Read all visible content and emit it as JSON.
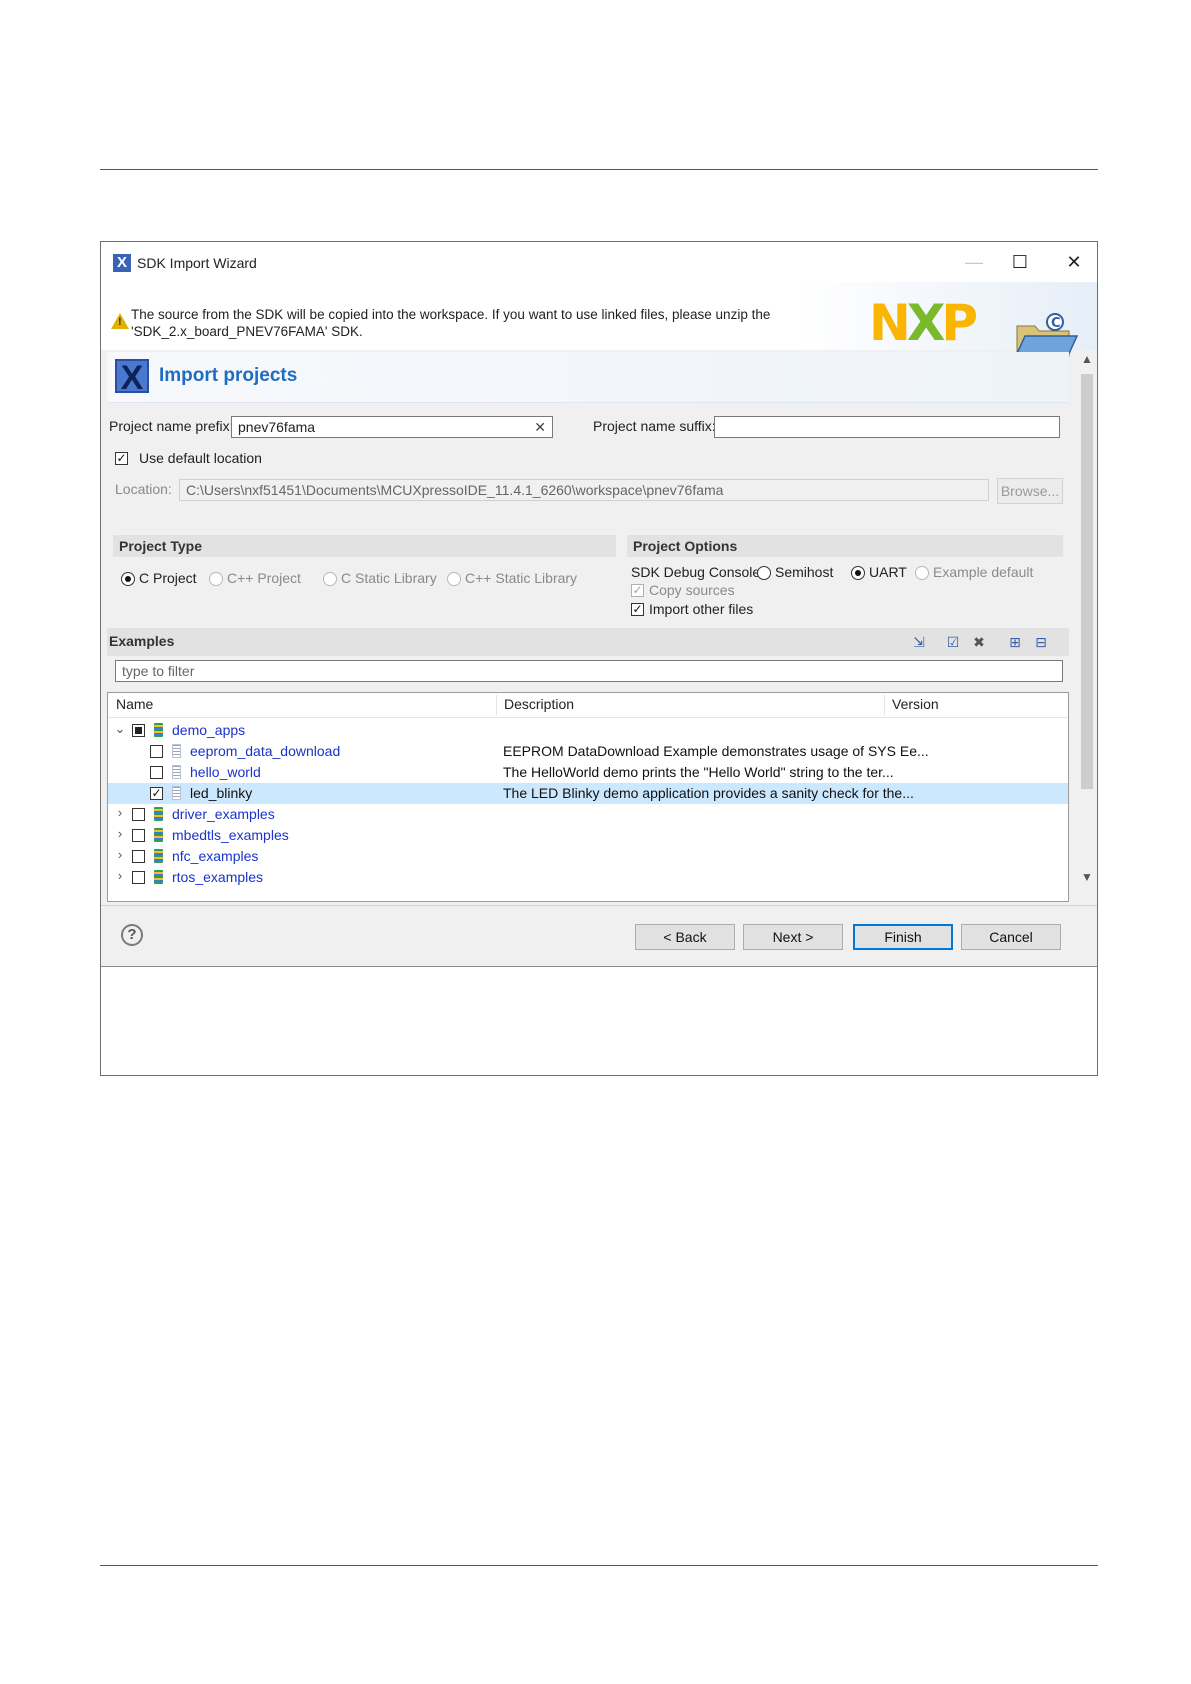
{
  "window": {
    "title": "SDK Import Wizard",
    "minimize_glyph": "—",
    "maximize_glyph": "☐",
    "close_glyph": "✕"
  },
  "warning": {
    "icon": "warning-icon",
    "line1": "The source from the SDK will be copied into the workspace. If you want to use linked files, please unzip the",
    "line2": "'SDK_2.x_board_PNEV76FAMA' SDK."
  },
  "logo": {
    "n": "N",
    "x": "X",
    "p": "P"
  },
  "page": {
    "title": "Import projects"
  },
  "project_name": {
    "prefix_label": "Project name prefix:",
    "prefix_value": "pnev76fama",
    "suffix_label": "Project name suffix:",
    "suffix_value": ""
  },
  "location": {
    "use_default_label": "Use default location",
    "use_default_checked": true,
    "label": "Location:",
    "value": "C:\\Users\\nxf51451\\Documents\\MCUXpressoIDE_11.4.1_6260\\workspace\\pnev76fama",
    "browse_label": "Browse..."
  },
  "project_type": {
    "heading": "Project Type",
    "options": [
      "C Project",
      "C++ Project",
      "C Static Library",
      "C++ Static Library"
    ],
    "selected": "C Project"
  },
  "project_options": {
    "heading": "Project Options",
    "debug_console_label": "SDK Debug Console",
    "console_options": [
      "Semihost",
      "UART",
      "Example default"
    ],
    "console_selected": "UART",
    "copy_sources_label": "Copy sources",
    "import_other_label": "Import other files"
  },
  "examples": {
    "heading": "Examples",
    "filter_placeholder": "type to filter",
    "columns": [
      "Name",
      "Description",
      "Version"
    ],
    "rows": [
      {
        "name": "demo_apps",
        "expanded": "⌄",
        "description": ""
      },
      {
        "name": "eeprom_data_download",
        "description": "EEPROM DataDownload Example demonstrates usage of SYS Ee..."
      },
      {
        "name": "hello_world",
        "description": "The HelloWorld demo prints the \"Hello World\" string to the ter..."
      },
      {
        "name": "led_blinky",
        "description": "The LED Blinky demo application provides a sanity check for the..."
      },
      {
        "name": "driver_examples",
        "expanded": "›",
        "description": ""
      },
      {
        "name": "mbedtls_examples",
        "expanded": "›",
        "description": ""
      },
      {
        "name": "nfc_examples",
        "expanded": "›",
        "description": ""
      },
      {
        "name": "rtos_examples",
        "expanded": "›",
        "description": ""
      }
    ],
    "checked": "✓"
  },
  "buttons": {
    "back": "< Back",
    "next": "Next >",
    "finish": "Finish",
    "cancel": "Cancel",
    "help": "?"
  },
  "colors": {
    "link_blue": "#1a33c9",
    "title_blue": "#1f6dc1",
    "selection": "#cce8ff",
    "default_button_border": "#0078d7"
  }
}
